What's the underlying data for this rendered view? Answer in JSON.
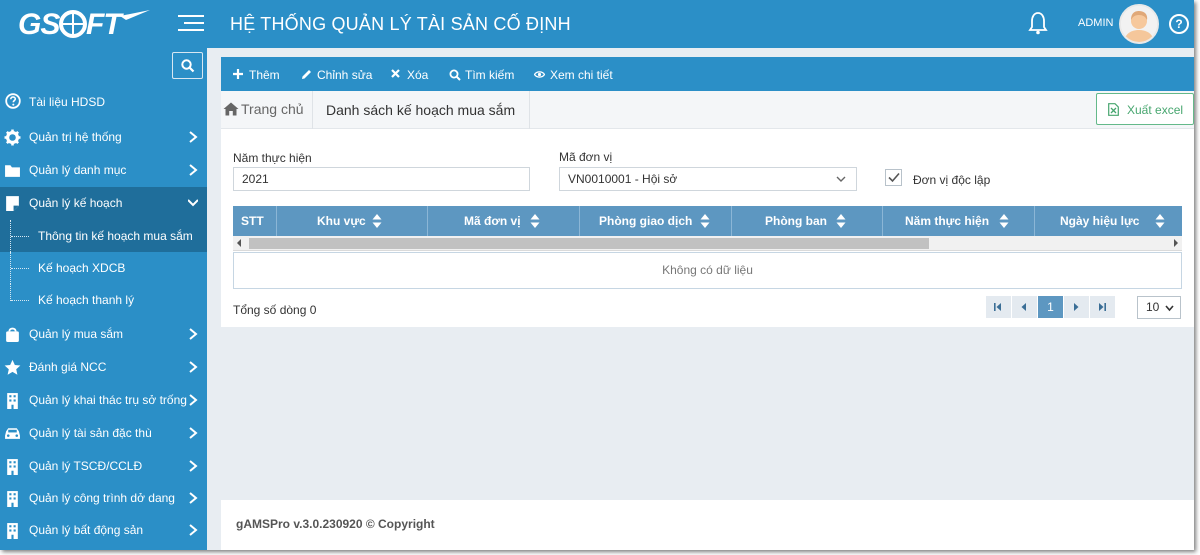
{
  "header": {
    "logo_text": "GSOFT",
    "title": "HỆ THỐNG QUẢN LÝ TÀI SẢN CỐ ĐỊNH",
    "user": "ADMIN",
    "help_icon": "question-circle-icon",
    "bell_icon": "bell-icon",
    "menu_icon": "hamburger-icon"
  },
  "sidebar": {
    "search_icon": "search-icon",
    "docs_label": "Tài liệu HDSD",
    "items": [
      {
        "label": "Quản trị hệ thống",
        "icon": "gear-icon"
      },
      {
        "label": "Quản lý danh mục",
        "icon": "folder-icon"
      },
      {
        "label": "Quản lý kế hoạch",
        "icon": "note-icon"
      },
      {
        "label": "Quản lý mua sắm",
        "icon": "bag-icon"
      },
      {
        "label": "Đánh giá NCC",
        "icon": "star-icon"
      },
      {
        "label": "Quản lý khai thác trụ sở trống",
        "icon": "building-icon"
      },
      {
        "label": "Quản lý tài sản đặc thù",
        "icon": "car-icon"
      },
      {
        "label": "Quản lý TSCĐ/CCLĐ",
        "icon": "building-icon"
      },
      {
        "label": "Quản lý công trình dở dang",
        "icon": "building-icon"
      },
      {
        "label": "Quản lý bất động sản",
        "icon": "building-icon"
      }
    ],
    "sub_items": [
      {
        "label": "Thông tin kế hoạch mua sắm"
      },
      {
        "label": "Kế hoạch XDCB"
      },
      {
        "label": "Kế hoạch thanh lý"
      }
    ]
  },
  "toolbar": {
    "add": "Thêm",
    "edit": "Chỉnh sửa",
    "delete": "Xóa",
    "search": "Tìm kiếm",
    "view": "Xem chi tiết"
  },
  "breadcrumb": {
    "home": "Trang chủ",
    "current": "Danh sách kế hoạch mua sắm"
  },
  "export_label": "Xuất excel",
  "filters": {
    "year_label": "Năm thực hiện",
    "year_value": "2021",
    "unit_label": "Mã đơn vị",
    "unit_value": "VN0010001 - Hội sở",
    "independent_label": "Đơn vị độc lập",
    "independent_checked": true
  },
  "table": {
    "columns": [
      "STT",
      "Khu vực",
      "Mã đơn vị",
      "Phòng giao dịch",
      "Phòng ban",
      "Năm thực hiện",
      "Ngày hiệu lực"
    ],
    "empty_text": "Không có dữ liệu",
    "total_text": "Tổng số dòng 0"
  },
  "pagination": {
    "current_page": "1",
    "page_size": "10"
  },
  "footer": "gAMSPro v.3.0.230920 © Copyright",
  "colors": {
    "primary": "#2b8fc7",
    "sidebar_active": "#1f6e9b",
    "grid_header": "#5d97c1",
    "export_green": "#47a66f"
  }
}
